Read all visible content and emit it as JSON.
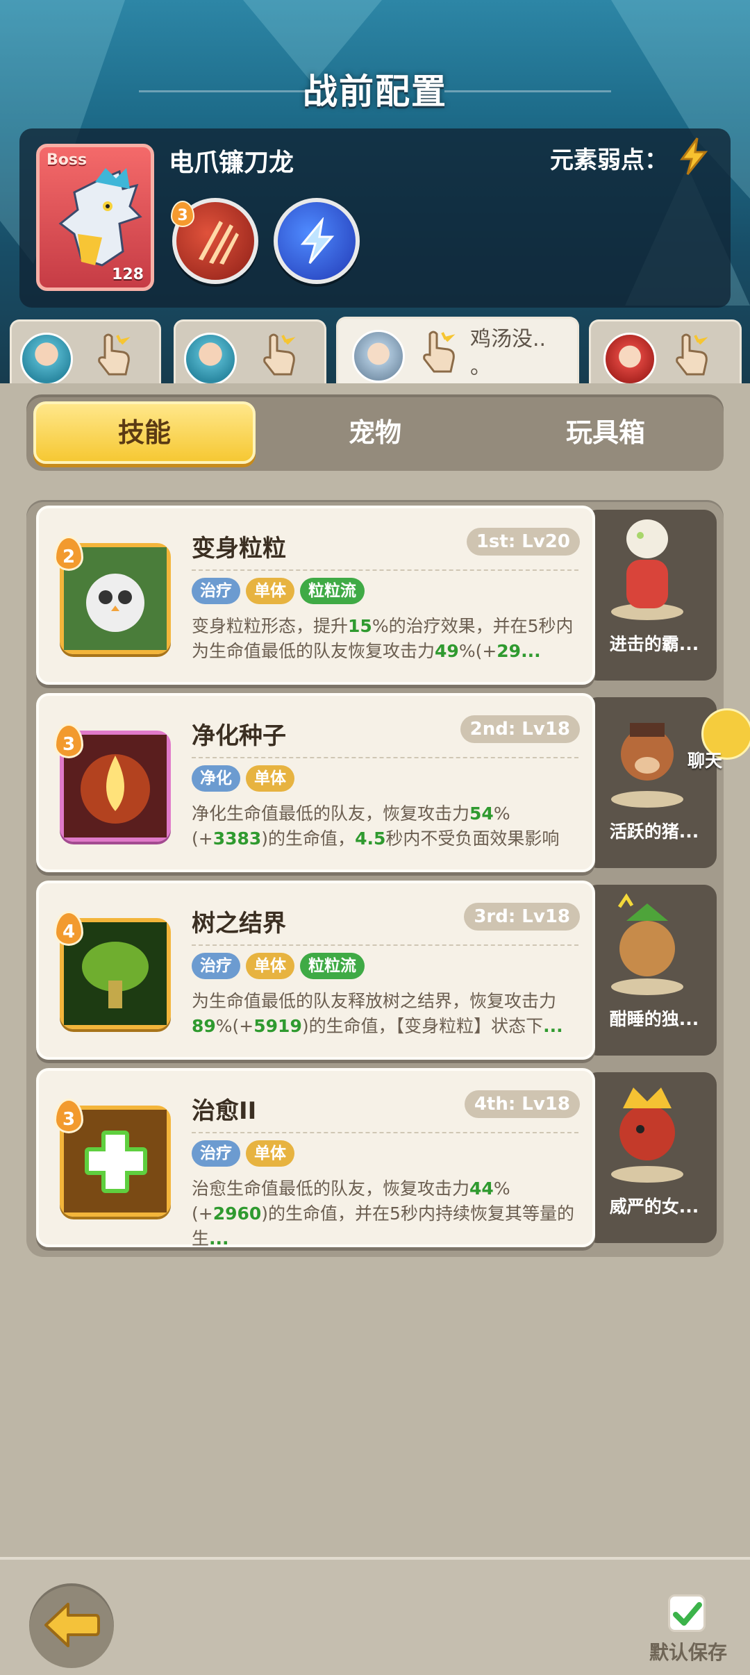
{
  "header": {
    "title": "战前配置"
  },
  "boss": {
    "tag": "Boss",
    "level": "128",
    "name": "电爪镰刀龙",
    "weakness_label": "元素弱点：",
    "weakness_icon": "lightning-icon",
    "skill_orb_badge": "3"
  },
  "team": {
    "slots": [
      {
        "avatar": "blue-hair-hero",
        "label": ""
      },
      {
        "avatar": "blue-hair-hero",
        "label": ""
      },
      {
        "avatar": "grey-hair-hero",
        "label": "鸡汤没..\n。"
      },
      {
        "avatar": "red-hair-hero",
        "label": ""
      }
    ],
    "active_index": 2
  },
  "tabs": [
    {
      "label": "技能",
      "active": true
    },
    {
      "label": "宠物",
      "active": false
    },
    {
      "label": "玩具箱",
      "active": false
    }
  ],
  "skills": [
    {
      "badge": "2",
      "name": "变身粒粒",
      "level": "1st: Lv20",
      "tags": [
        "治疗",
        "单体",
        "粒粒流"
      ],
      "desc_parts": [
        "变身粒粒形态，提升",
        "15",
        "%的治疗效果，并在5秒内为生命值最低的队友恢复攻击力",
        "49",
        "%(+",
        "29",
        "..."
      ],
      "pet_name": "进击的霸..."
    },
    {
      "badge": "3",
      "name": "净化种子",
      "level": "2nd: Lv18",
      "tags": [
        "净化",
        "单体"
      ],
      "desc_parts": [
        "净化生命值最低的队友，恢复攻击力",
        "54",
        "%(+",
        "3383",
        ")的生命值，",
        "4.5",
        "秒内不受负面效果影响"
      ],
      "pet_name": "活跃的猪..."
    },
    {
      "badge": "4",
      "name": "树之结界",
      "level": "3rd: Lv18",
      "tags": [
        "治疗",
        "单体",
        "粒粒流"
      ],
      "desc_parts": [
        "为生命值最低的队友释放树之结界，恢复攻击力",
        "89",
        "%(+",
        "5919",
        ")的生命值，【变身粒粒】状态下",
        "..."
      ],
      "pet_name": "酣睡的独..."
    },
    {
      "badge": "3",
      "name": "治愈II",
      "level": "4th: Lv18",
      "tags": [
        "治疗",
        "单体"
      ],
      "desc_parts": [
        "治愈生命值最低的队友，恢复攻击力",
        "44",
        "%(+",
        "2960",
        ")的生命值，并在5秒内持续恢复其等量的生",
        "..."
      ],
      "pet_name": "威严的女..."
    }
  ],
  "chat": {
    "label": "聊天"
  },
  "footer": {
    "save_label": "默认保存",
    "back_icon": "back-arrow-icon",
    "save_checked": true
  }
}
